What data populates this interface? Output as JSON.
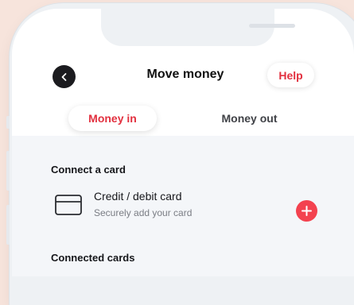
{
  "header": {
    "title": "Move money",
    "help_label": "Help"
  },
  "tabs": {
    "money_in": "Money in",
    "money_out": "Money out",
    "active": "Money in"
  },
  "sections": {
    "connect_card_heading": "Connect a card",
    "connected_cards_heading": "Connected cards"
  },
  "card_option": {
    "title": "Credit / debit card",
    "subtitle": "Securely add your card",
    "icon": "credit-card-icon"
  },
  "colors": {
    "accent": "#e2303f",
    "background": "#f7e4dc"
  }
}
